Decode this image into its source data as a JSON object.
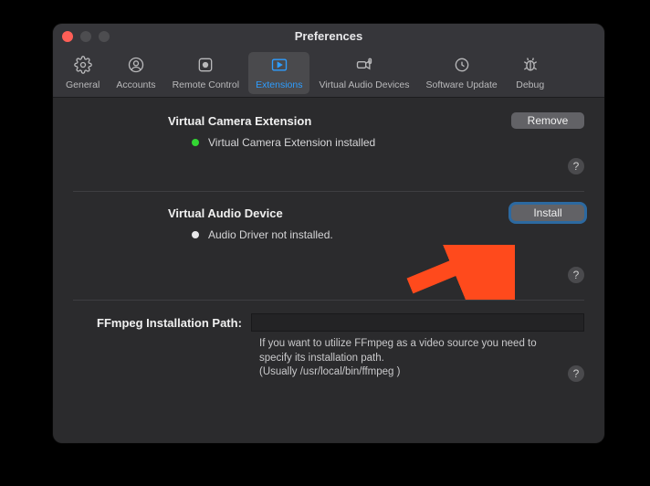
{
  "window": {
    "title": "Preferences"
  },
  "tabs": {
    "general": "General",
    "accounts": "Accounts",
    "remote": "Remote Control",
    "extensions": "Extensions",
    "vad": "Virtual Audio Devices",
    "update": "Software Update",
    "debug": "Debug"
  },
  "sections": {
    "camera": {
      "title": "Virtual Camera Extension",
      "button": "Remove",
      "status": "Virtual Camera Extension installed"
    },
    "audio": {
      "title": "Virtual Audio Device",
      "button": "Install",
      "status": "Audio Driver not installed."
    },
    "ffmpeg": {
      "label": "FFmpeg Installation Path:",
      "value": "",
      "note1": "If you want to utilize FFmpeg as a video source you need to specify its installation path.",
      "note2": "(Usually /usr/local/bin/ffmpeg )"
    }
  },
  "help": "?"
}
